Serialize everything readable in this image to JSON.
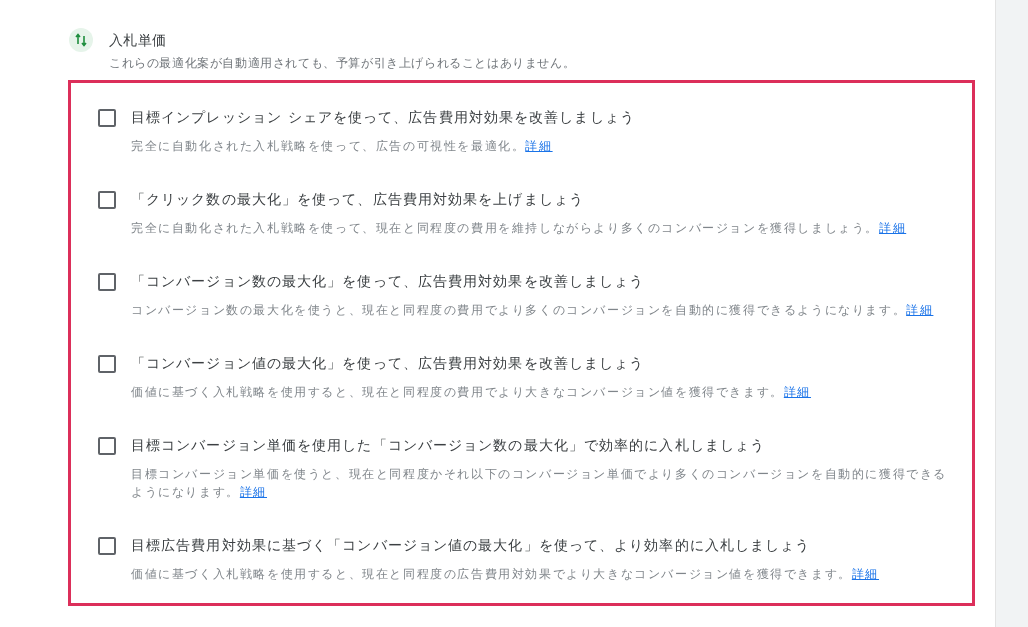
{
  "section": {
    "title": "入札単価",
    "subtitle": "これらの最適化案が自動適用されても、予算が引き上げられることはありません。"
  },
  "recommendations": [
    {
      "title": "目標インプレッション シェアを使って、広告費用対効果を改善しましょう",
      "description": "完全に自動化された入札戦略を使って、広告の可視性を最適化。",
      "link": "詳細",
      "checked": false
    },
    {
      "title": "「クリック数の最大化」を使って、広告費用対効果を上げましょう",
      "description": "完全に自動化された入札戦略を使って、現在と同程度の費用を維持しながらより多くのコンバージョンを獲得しましょう。",
      "link": "詳細",
      "checked": false
    },
    {
      "title": "「コンバージョン数の最大化」を使って、広告費用対効果を改善しましょう",
      "description": "コンバージョン数の最大化を使うと、現在と同程度の費用でより多くのコンバージョンを自動的に獲得できるようになります。",
      "link": "詳細",
      "checked": false
    },
    {
      "title": "「コンバージョン値の最大化」を使って、広告費用対効果を改善しましょう",
      "description": "価値に基づく入札戦略を使用すると、現在と同程度の費用でより大きなコンバージョン値を獲得できます。",
      "link": "詳細",
      "checked": false
    },
    {
      "title": "目標コンバージョン単価を使用した「コンバージョン数の最大化」で効率的に入札しましょう",
      "description": "目標コンバージョン単価を使うと、現在と同程度かそれ以下のコンバージョン単価でより多くのコンバージョンを自動的に獲得できるようになります。",
      "link": "詳細",
      "checked": false
    },
    {
      "title": "目標広告費用対効果に基づく「コンバージョン値の最大化」を使って、より効率的に入札しましょう",
      "description": "価値に基づく入札戦略を使用すると、現在と同程度の広告費用対効果でより大きなコンバージョン値を獲得できます。",
      "link": "詳細",
      "checked": false
    }
  ]
}
